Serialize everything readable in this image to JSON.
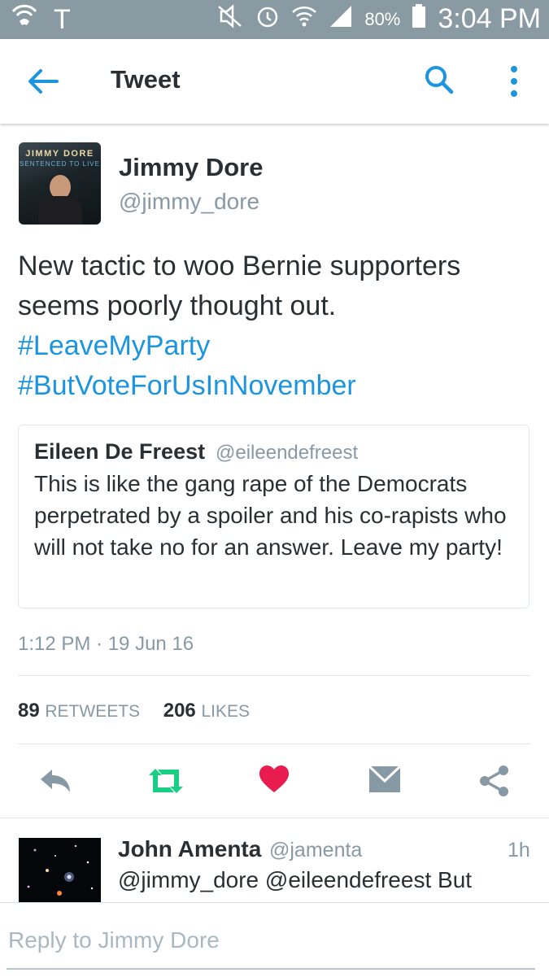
{
  "status_bar": {
    "carrier": "T",
    "battery": "80%",
    "time": "3:04 PM",
    "icons": [
      "wifi-call-icon",
      "mute-icon",
      "alarm-icon",
      "wifi-icon",
      "signal-icon",
      "battery-icon"
    ]
  },
  "header": {
    "title": "Tweet",
    "back_icon": "arrow-left-icon",
    "search_icon": "search-icon",
    "more_icon": "more-vertical-icon",
    "accent": "#1b95e0"
  },
  "tweet": {
    "name": "Jimmy Dore",
    "handle": "@jimmy_dore",
    "avatar_text": "JIMMY DORE",
    "avatar_subtext": "SENTENCED TO LIVE",
    "text": "New tactic to woo Bernie supporters seems poorly thought out.",
    "hashtags": [
      "#LeaveMyParty",
      "#ButVoteForUsInNovember"
    ],
    "quote": {
      "name": "Eileen De Freest",
      "handle": "@eileendefreest",
      "text": "This is like the gang rape of the Democrats perpetrated by a spoiler and his co-rapists who will not take no for an answer. Leave my party!"
    },
    "timestamp": "1:12 PM · 19 Jun 16",
    "retweets_count": "89",
    "retweets_label": "RETWEETS",
    "likes_count": "206",
    "likes_label": "LIKES",
    "like_color": "#e81c4f",
    "retweet_color": "#19cf86"
  },
  "actions": [
    "reply-icon",
    "retweet-icon",
    "heart-icon",
    "envelope-icon",
    "share-icon"
  ],
  "reply": {
    "name": "John Amenta",
    "handle": "@jamenta",
    "time": "1h",
    "text": "@jimmy_dore @eileendefreest But"
  },
  "compose": {
    "placeholder": "Reply to Jimmy Dore"
  }
}
